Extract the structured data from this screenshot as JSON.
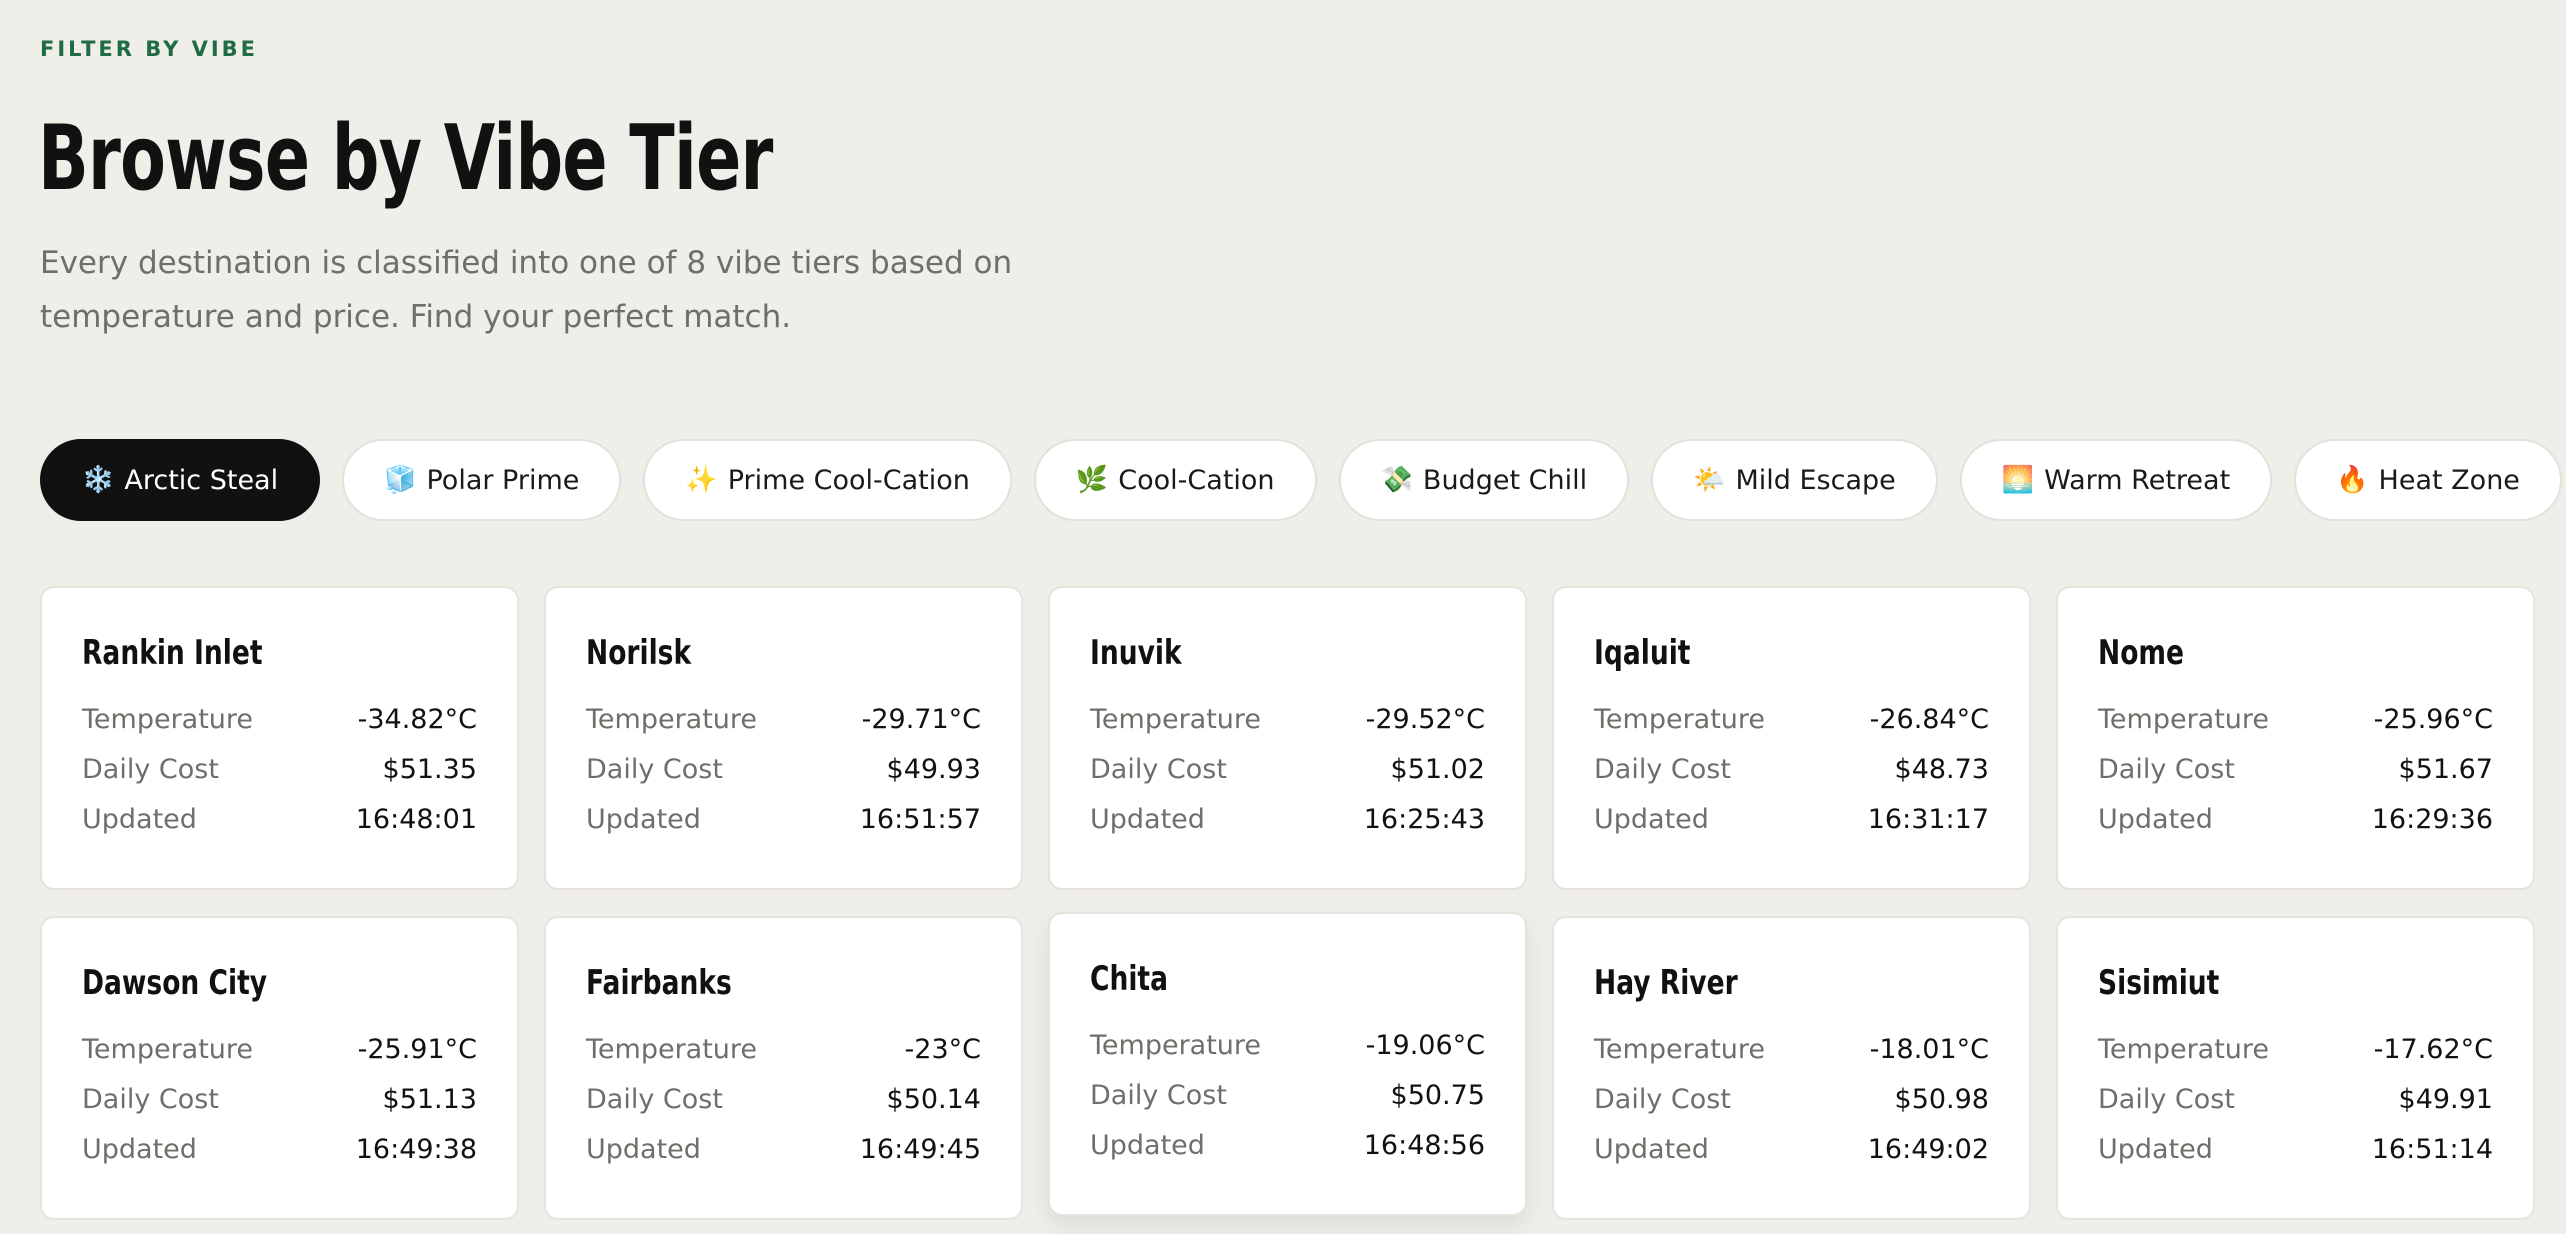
{
  "header": {
    "eyebrow": "FILTER BY VIBE",
    "title": "Browse by Vibe Tier",
    "subtitle": "Every destination is classified into one of 8 vibe tiers based on temperature and price. Find your perfect match."
  },
  "tabs": [
    {
      "icon": "❄️",
      "icon_name": "snowflake-icon",
      "label": "Arctic Steal",
      "active": true
    },
    {
      "icon": "🧊",
      "icon_name": "ice-cube-icon",
      "label": "Polar Prime",
      "active": false
    },
    {
      "icon": "✨",
      "icon_name": "sparkles-icon",
      "label": "Prime Cool-Cation",
      "active": false
    },
    {
      "icon": "🌿",
      "icon_name": "herb-icon",
      "label": "Cool-Cation",
      "active": false
    },
    {
      "icon": "💸",
      "icon_name": "money-wings-icon",
      "label": "Budget Chill",
      "active": false
    },
    {
      "icon": "🌤️",
      "icon_name": "sun-behind-cloud-icon",
      "label": "Mild Escape",
      "active": false
    },
    {
      "icon": "🌅",
      "icon_name": "sunrise-icon",
      "label": "Warm Retreat",
      "active": false
    },
    {
      "icon": "🔥",
      "icon_name": "fire-icon",
      "label": "Heat Zone",
      "active": false
    }
  ],
  "labels": {
    "temperature": "Temperature",
    "daily_cost": "Daily Cost",
    "updated": "Updated"
  },
  "destinations": [
    {
      "name": "Rankin Inlet",
      "temperature": "-34.82°C",
      "daily_cost": "$51.35",
      "updated": "16:48:01"
    },
    {
      "name": "Norilsk",
      "temperature": "-29.71°C",
      "daily_cost": "$49.93",
      "updated": "16:51:57"
    },
    {
      "name": "Inuvik",
      "temperature": "-29.52°C",
      "daily_cost": "$51.02",
      "updated": "16:25:43"
    },
    {
      "name": "Iqaluit",
      "temperature": "-26.84°C",
      "daily_cost": "$48.73",
      "updated": "16:31:17"
    },
    {
      "name": "Nome",
      "temperature": "-25.96°C",
      "daily_cost": "$51.67",
      "updated": "16:29:36"
    },
    {
      "name": "Dawson City",
      "temperature": "-25.91°C",
      "daily_cost": "$51.13",
      "updated": "16:49:38"
    },
    {
      "name": "Fairbanks",
      "temperature": "-23°C",
      "daily_cost": "$50.14",
      "updated": "16:49:45"
    },
    {
      "name": "Chita",
      "temperature": "-19.06°C",
      "daily_cost": "$50.75",
      "updated": "16:48:56",
      "hovered": true
    },
    {
      "name": "Hay River",
      "temperature": "-18.01°C",
      "daily_cost": "$50.98",
      "updated": "16:49:02"
    },
    {
      "name": "Sisimiut",
      "temperature": "-17.62°C",
      "daily_cost": "$49.91",
      "updated": "16:51:14"
    }
  ],
  "colors": {
    "background": "#efeee9",
    "accent": "#1f6b46",
    "active_tab": "#111111",
    "card": "#ffffff"
  }
}
